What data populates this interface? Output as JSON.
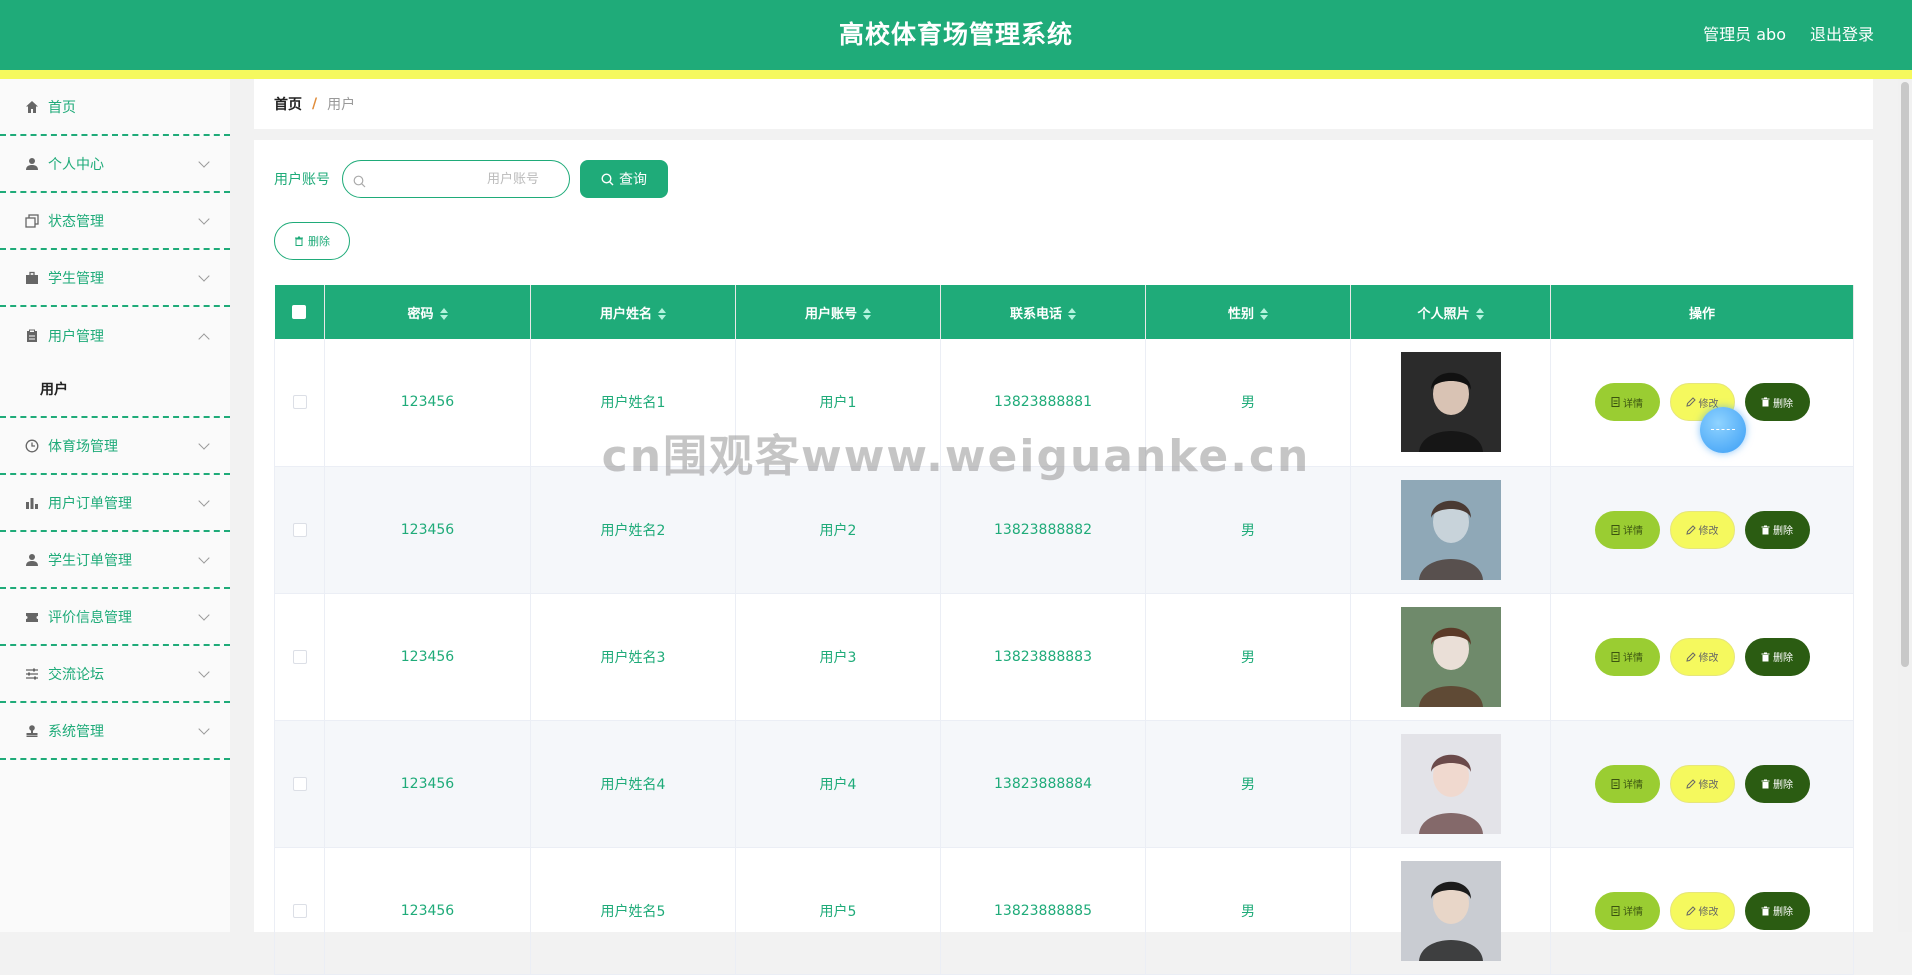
{
  "header": {
    "title": "高校体育场管理系统",
    "user_label": "管理员 abo",
    "logout_label": "退出登录",
    "colors": {
      "primary": "#1fab79",
      "stripe": "#f5f95e"
    }
  },
  "sidebar": {
    "items": [
      {
        "label": "首页",
        "icon": "home-icon"
      },
      {
        "label": "个人中心",
        "icon": "user-icon"
      },
      {
        "label": "状态管理",
        "icon": "copy-icon"
      },
      {
        "label": "学生管理",
        "icon": "briefcase-icon"
      },
      {
        "label": "用户管理",
        "icon": "clipboard-icon",
        "expanded": true,
        "children": [
          "用户"
        ]
      },
      {
        "label": "体育场管理",
        "icon": "clock-icon"
      },
      {
        "label": "用户订单管理",
        "icon": "bar-chart-icon"
      },
      {
        "label": "学生订单管理",
        "icon": "user-icon"
      },
      {
        "label": "评价信息管理",
        "icon": "ticket-icon"
      },
      {
        "label": "交流论坛",
        "icon": "sliders-icon"
      },
      {
        "label": "系统管理",
        "icon": "stamp-icon"
      }
    ]
  },
  "breadcrumb": {
    "home": "首页",
    "separator": "/",
    "current": "用户"
  },
  "search": {
    "label": "用户账号",
    "placeholder": "用户账号",
    "value": "",
    "button_label": "查询"
  },
  "bulk_delete_label": "删除",
  "table": {
    "columns": [
      "密码",
      "用户姓名",
      "用户账号",
      "联系电话",
      "性别",
      "个人照片",
      "操作"
    ],
    "rows": [
      {
        "password": "123456",
        "name": "用户姓名1",
        "account": "用户1",
        "phone": "13823888881",
        "gender": "男"
      },
      {
        "password": "123456",
        "name": "用户姓名2",
        "account": "用户2",
        "phone": "13823888882",
        "gender": "男"
      },
      {
        "password": "123456",
        "name": "用户姓名3",
        "account": "用户3",
        "phone": "13823888883",
        "gender": "男"
      },
      {
        "password": "123456",
        "name": "用户姓名4",
        "account": "用户4",
        "phone": "13823888884",
        "gender": "男"
      },
      {
        "password": "123456",
        "name": "用户姓名5",
        "account": "用户5",
        "phone": "13823888885",
        "gender": "男"
      }
    ],
    "actions": {
      "detail": "详情",
      "edit": "修改",
      "delete": "删除"
    }
  },
  "watermark": "cn围观客www.weiguanke.cn"
}
